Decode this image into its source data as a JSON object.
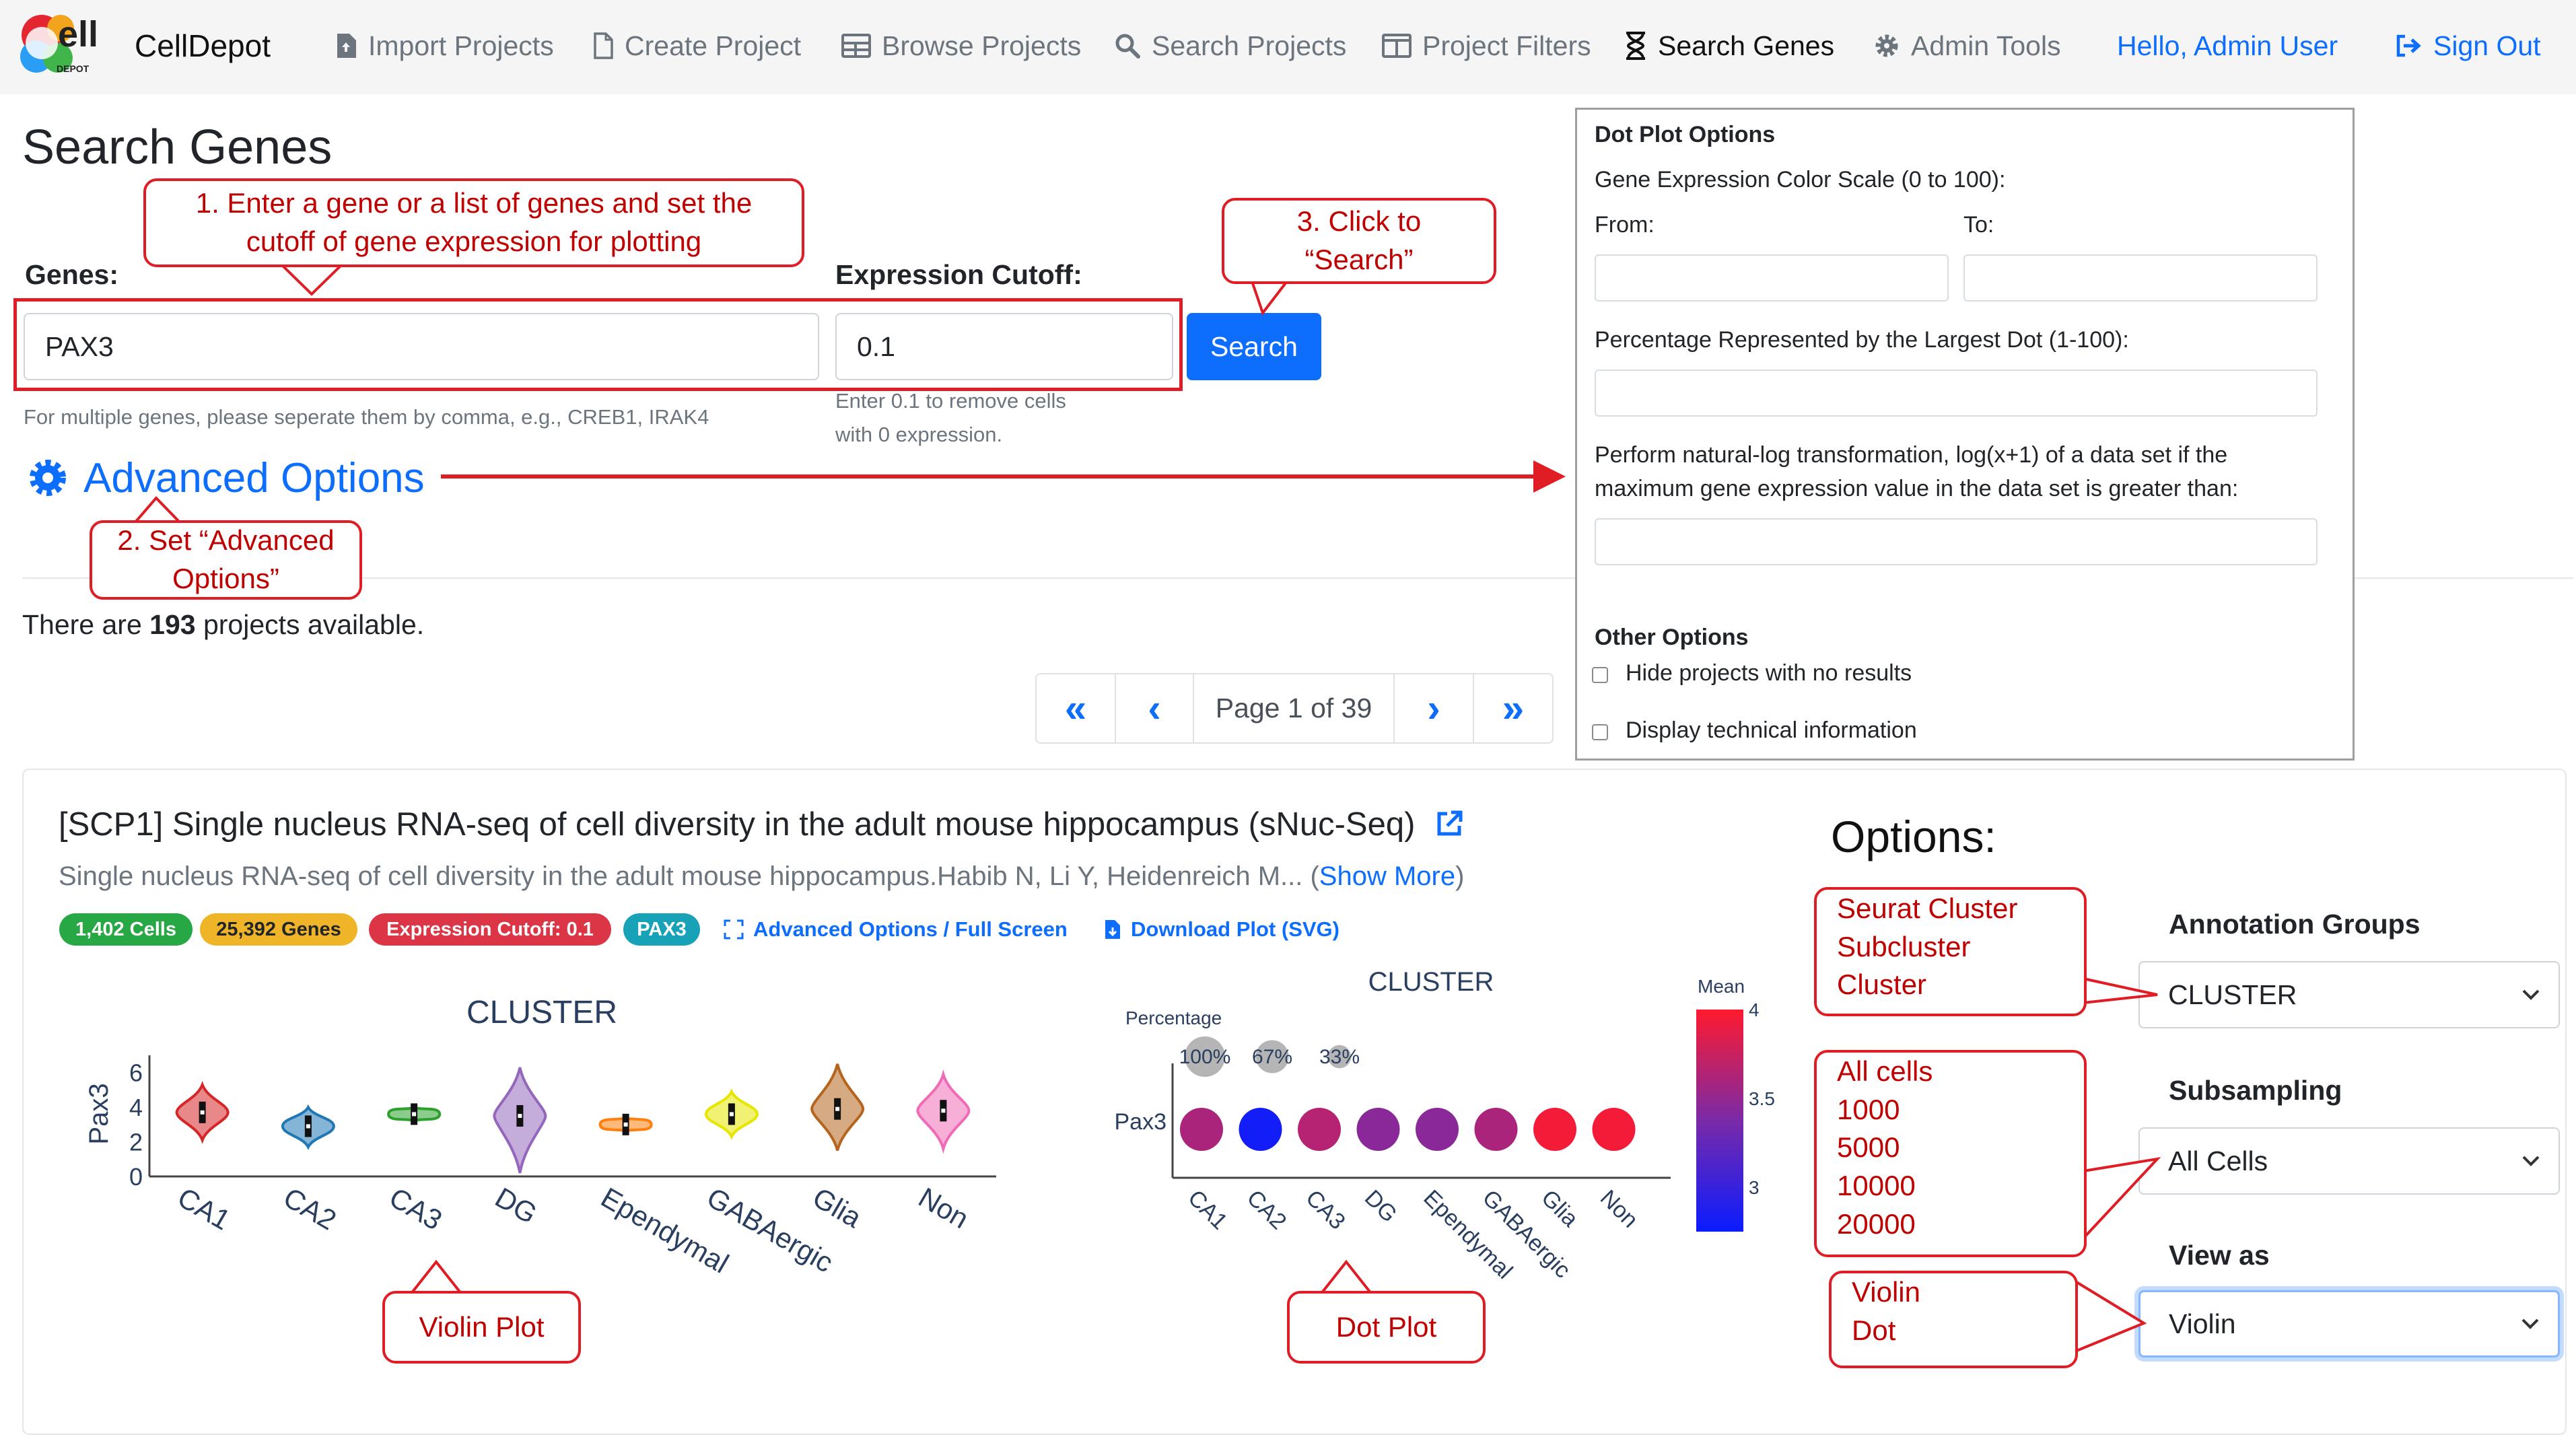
{
  "nav": {
    "brand": "CellDepot",
    "logo_text": "ell",
    "logo_sub": "DEPOT",
    "items": [
      {
        "label": "Import Projects",
        "icon": "file-import-icon"
      },
      {
        "label": "Create Project",
        "icon": "file-icon"
      },
      {
        "label": "Browse Projects",
        "icon": "table-icon"
      },
      {
        "label": "Search Projects",
        "icon": "search-icon"
      },
      {
        "label": "Project Filters",
        "icon": "columns-icon"
      },
      {
        "label": "Search Genes",
        "icon": "hourglass-icon",
        "active": true
      },
      {
        "label": "Admin Tools",
        "icon": "gear-icon"
      }
    ],
    "user_greeting": "Hello, Admin User",
    "signout": "Sign Out"
  },
  "page_title": "Search Genes",
  "form": {
    "genes_label": "Genes:",
    "genes_value": "PAX3",
    "genes_help": "For multiple genes, please seperate them by comma, e.g., CREB1, IRAK4",
    "cutoff_label": "Expression Cutoff:",
    "cutoff_value": "0.1",
    "cutoff_help_1": "Enter 0.1 to remove cells",
    "cutoff_help_2": "with 0 expression.",
    "search_button": "Search",
    "advanced_options": "Advanced Options"
  },
  "projects_count": {
    "prefix": "There are ",
    "count": "193",
    "suffix": " projects available."
  },
  "pagination": {
    "first": "«",
    "prev": "‹",
    "page_text": "Page 1 of 39",
    "next": "›",
    "last": "»"
  },
  "dot_plot_options": {
    "title": "Dot Plot Options",
    "color_scale_label": "Gene Expression Color Scale (0 to 100):",
    "from_label": "From:",
    "to_label": "To:",
    "largest_dot_label": "Percentage Represented by the Largest Dot (1-100):",
    "log_label_1": "Perform natural-log transformation, log(x+1) of a data set if the",
    "log_label_2": "maximum gene expression value in the data set is greater than:",
    "other_title": "Other Options",
    "hide_projects": "Hide projects with no results",
    "display_technical": "Display technical information"
  },
  "project": {
    "title": "[SCP1] Single nucleus RNA-seq of cell diversity in the adult mouse hippocampus (sNuc-Seq)",
    "description": "Single nucleus RNA-seq of cell diversity in the adult mouse hippocampus.Habib N, Li Y, Heidenreich M... (",
    "show_more": "Show More",
    "desc_close": ")",
    "badges": [
      {
        "text": "1,402 Cells",
        "color": "#28a745",
        "text_color": "#ffffff"
      },
      {
        "text": "25,392 Genes",
        "color": "#f0b429",
        "text_color": "#212529"
      },
      {
        "text": "Expression Cutoff: 0.1",
        "color": "#dc3545",
        "text_color": "#ffffff"
      },
      {
        "text": "PAX3",
        "color": "#17a2b8",
        "text_color": "#ffffff"
      }
    ],
    "advanced_fullscreen": "Advanced Options / Full Screen",
    "download_plot": "Download Plot (SVG)"
  },
  "options": {
    "heading": "Options:",
    "annotation_label": "Annotation Groups",
    "annotation_value": "CLUSTER",
    "subsampling_label": "Subsampling",
    "subsampling_value": "All Cells",
    "view_label": "View as",
    "view_value": "Violin"
  },
  "callouts": {
    "step1_line1": "1. Enter a gene or a list of genes and set the",
    "step1_line2": "cutoff of gene expression for plotting",
    "step2_line1": "2. Set “Advanced",
    "step2_line2": "Options”",
    "step3_line1": "3. Click to",
    "step3_line2": "“Search”",
    "annotation_opts": [
      "Seurat Cluster",
      "Subcluster",
      "Cluster"
    ],
    "subsampling_opts": [
      "All cells",
      "1000",
      "5000",
      "10000",
      "20000"
    ],
    "view_opts": [
      "Violin",
      "Dot"
    ],
    "violin_plot": "Violin Plot",
    "dot_plot": "Dot Plot"
  },
  "chart_data": [
    {
      "type": "violin",
      "title": "CLUSTER",
      "ylabel": "Pax3",
      "ylim": [
        0,
        7
      ],
      "yticks": [
        0,
        2,
        4,
        6
      ],
      "categories": [
        "CA1",
        "CA2",
        "CA3",
        "DG",
        "Ependymal",
        "GABAergic",
        "Glia",
        "Non"
      ],
      "colors": [
        "#d62728",
        "#1f77b4",
        "#2ca02c",
        "#9467bd",
        "#ff7f0e",
        "#e6e600",
        "#b5651d",
        "#f06bb6"
      ],
      "medians": [
        3.7,
        2.9,
        3.6,
        3.5,
        3.0,
        3.6,
        3.9,
        3.8
      ],
      "min": [
        2.1,
        1.7,
        3.2,
        0.2,
        2.6,
        2.3,
        1.5,
        1.6
      ],
      "max": [
        5.3,
        4.0,
        4.0,
        6.3,
        3.4,
        4.9,
        6.5,
        5.9
      ]
    },
    {
      "type": "dot",
      "title": "CLUSTER",
      "gene": "Pax3",
      "percentage_label": "Percentage",
      "size_legend": [
        "100%",
        "67%",
        "33%"
      ],
      "categories": [
        "CA1",
        "CA2",
        "CA3",
        "DG",
        "Ependymal",
        "GABAergic",
        "Glia",
        "Non"
      ],
      "mean": [
        3.6,
        2.8,
        3.65,
        3.45,
        3.45,
        3.6,
        3.95,
        3.95
      ],
      "percent": [
        100,
        100,
        100,
        100,
        100,
        100,
        100,
        100
      ],
      "colorbar_title": "Mean",
      "colorbar_ticks": [
        3,
        3.5,
        4
      ],
      "colorbar_range": [
        2.75,
        4
      ]
    }
  ]
}
